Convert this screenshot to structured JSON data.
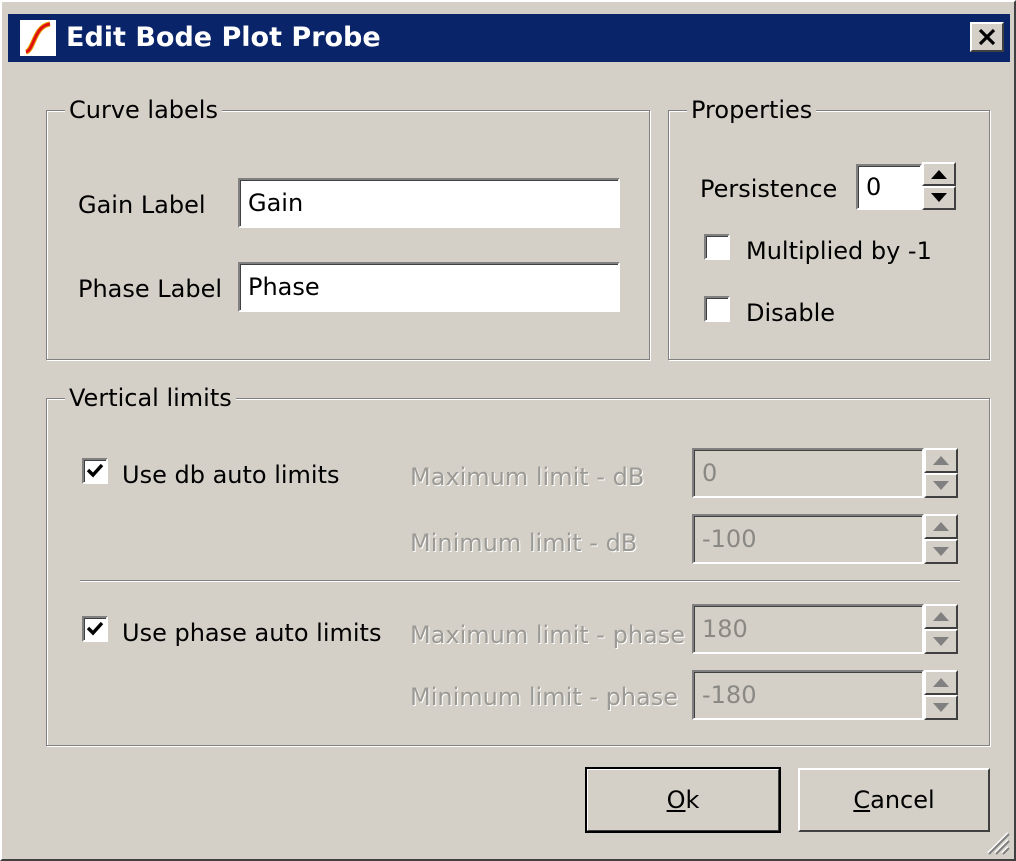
{
  "window": {
    "title": "Edit Bode Plot Probe"
  },
  "curve_labels": {
    "legend": "Curve labels",
    "gain_label": "Gain Label",
    "gain_value": "Gain",
    "phase_label": "Phase Label",
    "phase_value": "Phase"
  },
  "properties": {
    "legend": "Properties",
    "persistence_label": "Persistence",
    "persistence_value": "0",
    "multiplied_label": "Multiplied by -1",
    "multiplied_checked": false,
    "disable_label": "Disable",
    "disable_checked": false
  },
  "vertical_limits": {
    "legend": "Vertical limits",
    "db_auto_label": "Use db auto limits",
    "db_auto_checked": true,
    "max_db_label": "Maximum limit - dB",
    "max_db_value": "0",
    "min_db_label": "Minimum limit - dB",
    "min_db_value": "-100",
    "phase_auto_label": "Use phase auto limits",
    "phase_auto_checked": true,
    "max_phase_label": "Maximum limit - phase",
    "max_phase_value": "180",
    "min_phase_label": "Minimum limit - phase",
    "min_phase_value": "-180"
  },
  "buttons": {
    "ok_mnemonic": "O",
    "ok_rest": "k",
    "cancel_mnemonic": "C",
    "cancel_rest": "ancel"
  },
  "colors": {
    "titlebar": "#0a246a",
    "face": "#d4d0c8",
    "disabled_text": "#9c9a94"
  }
}
